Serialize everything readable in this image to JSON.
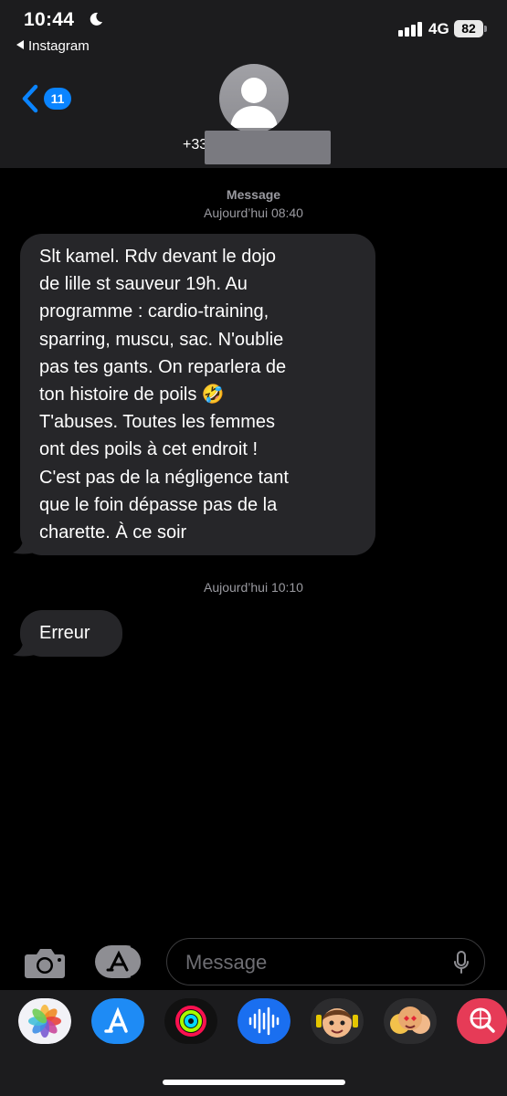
{
  "status_bar": {
    "time": "10:44",
    "back_app": "Instagram",
    "network": "4G",
    "battery": "82"
  },
  "nav": {
    "back_count": "11",
    "contact_number": "+33"
  },
  "conversation": {
    "header_label": "Message",
    "first_timestamp": "Aujourd’hui 08:40",
    "message_1": "Slt kamel.  Rdv devant le dojo\nde lille st sauveur 19h.  Au\nprogramme : cardio-training,\nsparring, muscu, sac.  N'oublie\npas tes gants.  On reparlera de\nton histoire de poils 🤣\nT'abuses. Toutes les femmes\nont des poils à cet endroit !\nC'est pas de la négligence tant\nque le foin dépasse pas de la\ncharette.  À  ce soir",
    "second_timestamp": "Aujourd’hui 10:10",
    "message_2": "Erreur"
  },
  "composer": {
    "placeholder": "Message"
  },
  "app_strip": {
    "icons": [
      "photos-icon",
      "app-store-icon",
      "activity-icon",
      "audio-message-icon",
      "memoji-icon",
      "memoji-stickers-icon",
      "web-search-icon"
    ]
  },
  "colors": {
    "header_bg": "#1c1c1e",
    "bubble_bg": "#262629",
    "accent_blue": "#0a84ff"
  }
}
